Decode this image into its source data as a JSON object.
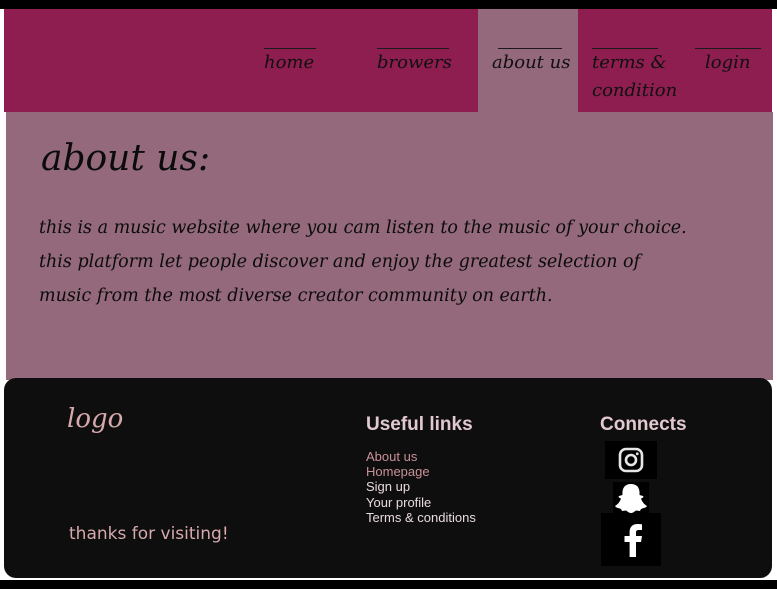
{
  "nav": {
    "items": [
      {
        "label": "home",
        "active": false
      },
      {
        "label": "browers",
        "active": false
      },
      {
        "label": "about us",
        "active": true
      },
      {
        "label": "terms & condition",
        "active": false
      },
      {
        "label": "login",
        "active": false
      }
    ]
  },
  "main": {
    "title": "about us:",
    "text": "this is a music website where you cam listen to the music of your choice. this platform let people discover and enjoy the greatest selection of music from the most diverse creator community on earth."
  },
  "footer": {
    "logo": "logo",
    "thanks": "thanks for visiting!",
    "links_title": "Useful links",
    "links": [
      "About us",
      "Homepage",
      "Sign up",
      "Your profile",
      "Terms & conditions"
    ],
    "connects_title": "Connects",
    "social_icons": [
      "instagram-icon",
      "snapchat-icon",
      "facebook-icon"
    ]
  },
  "colors": {
    "nav_bg": "#8e1d50",
    "active_bg": "#93697b",
    "footer_bg": "#0f0e0e",
    "footer_text": "#d6a9ad"
  }
}
